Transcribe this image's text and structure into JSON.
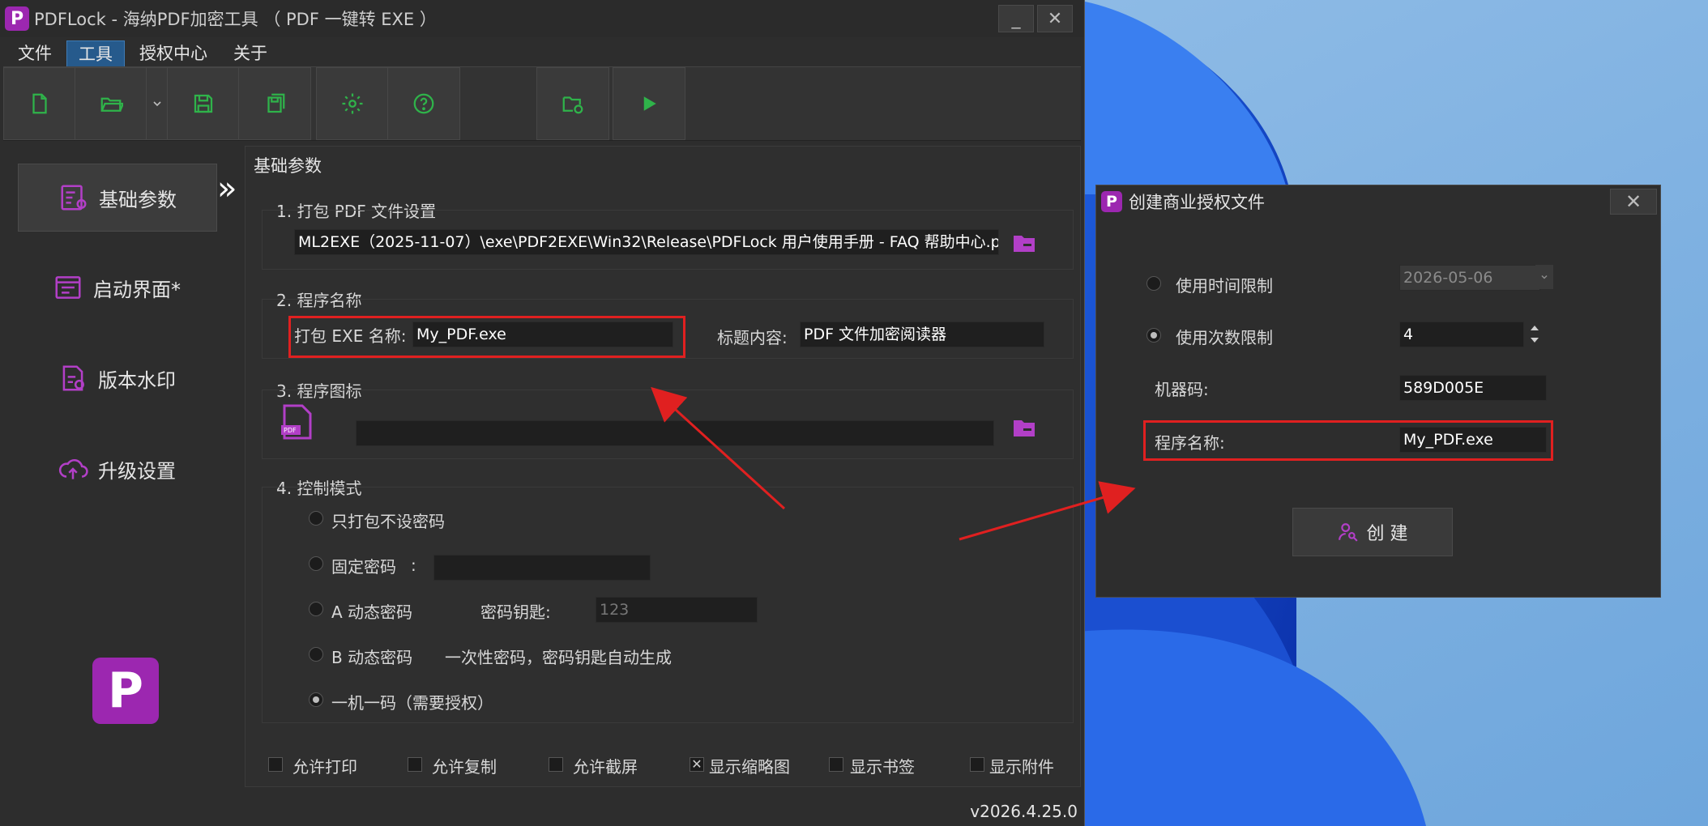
{
  "main_window": {
    "title": "PDFLock - 海纳PDF加密工具 （ PDF 一键转 EXE ）",
    "logo_letter": "P",
    "minimize_glyph": "_",
    "close_glyph": "✕",
    "menu": [
      "文件",
      "工具",
      "授权中心",
      "关于"
    ],
    "active_menu": "工具",
    "toolbar": [
      "new-file-icon",
      "open-folder-icon",
      "dropdown-arrow-icon",
      "save-icon",
      "save-as-icon",
      "settings-gear-icon",
      "help-icon",
      "build-folder-icon",
      "run-play-icon"
    ],
    "nav": {
      "items": [
        "基础参数",
        "启动界面*",
        "版本水印",
        "升级设置"
      ],
      "active": "基础参数",
      "collapse_glyph": "»"
    },
    "panel_title": "基础参数",
    "sections": {
      "pdf": {
        "label": "1. 打包 PDF 文件设置",
        "path": "ML2EXE（2025-11-07）\\exe\\PDF2EXE\\Win32\\Release\\PDFLock 用户使用手册 - FAQ 帮助中心.pdf"
      },
      "program": {
        "label": "2. 程序名称",
        "exe_label": "打包 EXE 名称:",
        "exe_value": "My_PDF.exe",
        "title_label": "标题内容:",
        "title_value": "PDF 文件加密阅读器"
      },
      "icon": {
        "label": "3. 程序图标",
        "path": ""
      },
      "control": {
        "label": "4. 控制模式",
        "options": [
          "只打包不设密码",
          "固定密码",
          "A 动态密码",
          "B 动态密码",
          "一机一码（需要授权）"
        ],
        "fixed_sep": ":",
        "key_label": "密码钥匙:",
        "key_placeholder": "123",
        "b_note": "一次性密码，密码钥匙自动生成",
        "selected": 4
      }
    },
    "permissions": [
      {
        "label": "允许打印",
        "checked": false
      },
      {
        "label": "允许复制",
        "checked": false
      },
      {
        "label": "允许截屏",
        "checked": false
      },
      {
        "label": "显示缩略图",
        "checked": true
      },
      {
        "label": "显示书签",
        "checked": false
      },
      {
        "label": "显示附件",
        "checked": false
      }
    ],
    "version": "v2026.4.25.0"
  },
  "dialog": {
    "title": "创建商业授权文件",
    "logo_letter": "P",
    "close_glyph": "✕",
    "time_limit_label": "使用时间限制",
    "time_limit_value": "2026-05-06",
    "count_limit_label": "使用次数限制",
    "count_limit_value": "4",
    "machine_label": "机器码:",
    "machine_value": "589D005E",
    "program_label": "程序名称:",
    "program_value": "My_PDF.exe",
    "create_label": "创 建",
    "selected": "count"
  },
  "colors": {
    "accent_purple": "#9c27b0",
    "toolbar_green": "#2fb34a",
    "highlight_red": "#e02020",
    "menu_active": "#265a8c"
  }
}
